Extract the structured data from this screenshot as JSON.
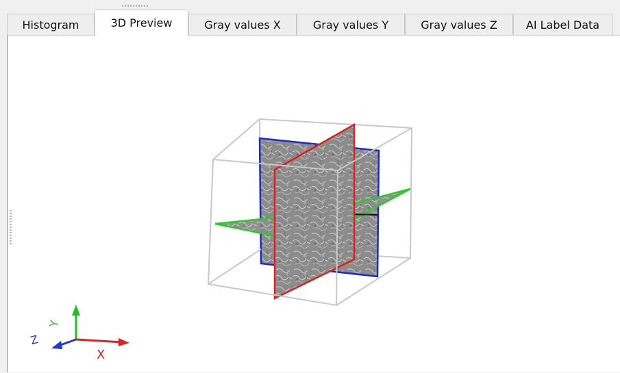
{
  "tabs": [
    {
      "label": "Histogram",
      "active": false
    },
    {
      "label": "3D Preview",
      "active": true
    },
    {
      "label": "Gray values X",
      "active": false
    },
    {
      "label": "Gray values Y",
      "active": false
    },
    {
      "label": "Gray values Z",
      "active": false
    },
    {
      "label": "AI Label Data",
      "active": false
    }
  ],
  "colors": {
    "slice_x": "#e02020",
    "slice_y": "#1a2ad0",
    "slice_z": "#22d022",
    "bounding_box": "#c8c8c8",
    "axis_x": "#e02020",
    "axis_y": "#20c020",
    "axis_z": "#1a3ad0"
  },
  "axes": {
    "x_label": "X",
    "y_label": "Y",
    "z_label": "Z"
  }
}
